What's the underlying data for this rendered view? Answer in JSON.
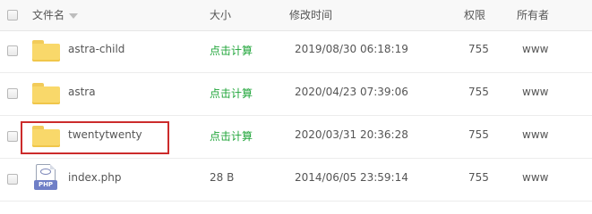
{
  "header": {
    "name": "文件名",
    "size": "大小",
    "mtime": "修改时间",
    "perm": "权限",
    "owner": "所有者"
  },
  "rows": [
    {
      "type": "folder",
      "name": "astra-child",
      "size": "点击计算",
      "mtime": "2019/08/30 06:18:19",
      "perm": "755",
      "owner": "www"
    },
    {
      "type": "folder",
      "name": "astra",
      "size": "点击计算",
      "mtime": "2020/04/23 07:39:06",
      "perm": "755",
      "owner": "www"
    },
    {
      "type": "folder",
      "name": "twentytwenty",
      "size": "点击计算",
      "mtime": "2020/03/31 20:36:28",
      "perm": "755",
      "owner": "www",
      "highlighted": true
    },
    {
      "type": "php",
      "name": "index.php",
      "size": "28 B",
      "mtime": "2014/06/05 23:59:14",
      "perm": "755",
      "owner": "www",
      "icon_label": "PHP"
    }
  ],
  "colors": {
    "calc_link": "#20a53a",
    "highlight_border": "#cc2b2b",
    "folder": "#f9d86a",
    "php_badge": "#6f7fc7"
  }
}
